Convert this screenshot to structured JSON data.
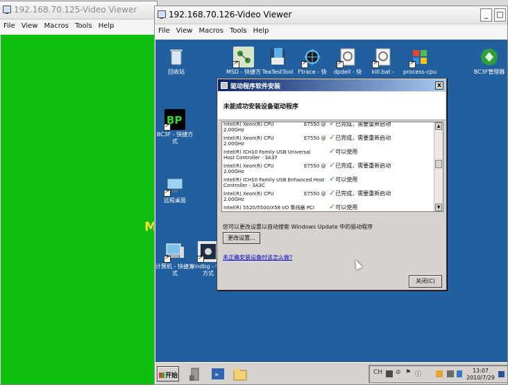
{
  "left_viewer": {
    "title": "192.168.70.125-Video Viewer",
    "menu": [
      "File",
      "View",
      "Macros",
      "Tools",
      "Help"
    ],
    "edge_letter": "M",
    "background_color": "#0ec00e"
  },
  "right_viewer": {
    "title": "192.168.70.126-Video Viewer",
    "menu": [
      "File",
      "View",
      "Macros",
      "Tools",
      "Help"
    ],
    "minimize_glyph": "_",
    "restore_glyph": "□",
    "desktop_color": "#225f9e"
  },
  "desktop_icons": [
    {
      "label": "回收站",
      "icon": "recycle-bin-icon"
    },
    {
      "label": "MSD - 快捷方",
      "icon": "network-tool-icon"
    },
    {
      "label": "TeaTestTool",
      "icon": "test-tool-icon"
    },
    {
      "label": "Ftrace - 快",
      "icon": "ftrace-icon"
    },
    {
      "label": "dpdell - 快",
      "icon": "script-icon"
    },
    {
      "label": "kill.bat - ",
      "icon": "batch-file-icon"
    },
    {
      "label": "process-cpu",
      "icon": "process-icon"
    },
    {
      "label": "BC3F管理器",
      "icon": "recycle-manager-icon"
    },
    {
      "label": "BC3F - 快捷方式",
      "icon": "bp-icon"
    },
    {
      "label": "远程桌面",
      "icon": "remote-desktop-icon"
    },
    {
      "label": "计算机 - 快捷方式",
      "icon": "computer-icon"
    },
    {
      "label": "windbg - 快捷方式",
      "icon": "windbg-icon"
    }
  ],
  "dialog": {
    "title": "驱动程序软件安装",
    "heading": "未能成功安装设备驱动程序",
    "close_glyph": "x",
    "devices": [
      {
        "name": "Intel(R) Xeon(R) CPU",
        "line2": "2.00GHz",
        "rev": "E7550 @",
        "status": "已完成，需要重新启动"
      },
      {
        "name": "Intel(R) Xeon(R) CPU",
        "line2": "2.00GHz",
        "rev": "E7550 @",
        "status": "已完成，需要重新启动"
      },
      {
        "name": "Intel(R) ICH10 Family USB Universal",
        "line2": "Host Controller - 3A37",
        "rev": "",
        "status": "可以使用"
      },
      {
        "name": "Intel(R) Xeon(R) CPU",
        "line2": "2.00GHz",
        "rev": "E7550 @",
        "status": "已完成，需要重新启动"
      },
      {
        "name": "Intel(R) ICH10 Family USB Enhanced Host",
        "line2": "Controller - 3A3C",
        "rev": "",
        "status": "可以使用"
      },
      {
        "name": "Intel(R) Xeon(R) CPU",
        "line2": "2.00GHz",
        "rev": "E7550 @",
        "status": "已完成，需要重新启动"
      },
      {
        "name": "Intel(R) 5520/5500/X58 I/O 集线器 PCI",
        "line2": "",
        "rev": "",
        "status": "可以使用"
      }
    ],
    "note": "您可以更改设置以自动搜索 Windows Update 中的驱动程序",
    "change_settings_button": "更改设置...",
    "link": "未正确安装设备时该怎么做?",
    "close_button": "关闭(C)"
  },
  "taskbar": {
    "start_label": "开始",
    "tray": [
      "CH",
      "⊘",
      "⚑",
      "ⓘ"
    ],
    "time": "13:07",
    "date": "2010/7/29"
  }
}
